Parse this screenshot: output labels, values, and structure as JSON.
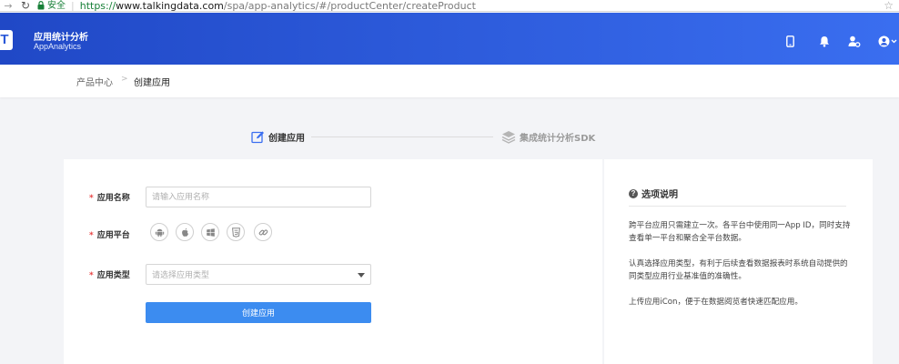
{
  "browser": {
    "secure_label": "安全",
    "url_proto": "https://",
    "url_host": "www.talkingdata.com",
    "url_path": "/spa/app-analytics/#/productCenter/createProduct"
  },
  "header": {
    "logo_letter": "T",
    "title": "应用统计分析",
    "subtitle": "AppAnalytics"
  },
  "breadcrumb": {
    "parent": "产品中心",
    "separator": ">",
    "current": "创建应用"
  },
  "steps": [
    {
      "label": "创建应用",
      "active": true
    },
    {
      "label": "集成统计分析SDK",
      "active": false
    }
  ],
  "form": {
    "name_label": "应用名称",
    "name_placeholder": "请输入应用名称",
    "platform_label": "应用平台",
    "platforms": [
      "android-icon",
      "apple-icon",
      "windows-icon",
      "html5-icon",
      "link-icon"
    ],
    "type_label": "应用类型",
    "type_placeholder": "请选择应用类型",
    "required_mark": "*",
    "submit_label": "创建应用"
  },
  "help": {
    "title": "选项说明",
    "paragraphs": [
      "跨平台应用只需建立一次。各平台中使用同一App ID，同时支持查看单一平台和聚合全平台数据。",
      "认真选择应用类型，有利于后续查看数据报表时系统自动提供的同类型应用行业基准值的准确性。",
      "上传应用iCon，便于在数据阅览者快速匹配应用。"
    ]
  },
  "colors": {
    "header_start": "#2048c6",
    "header_end": "#3a6ef0",
    "primary_button": "#3c8cf0",
    "required": "#e84343"
  }
}
